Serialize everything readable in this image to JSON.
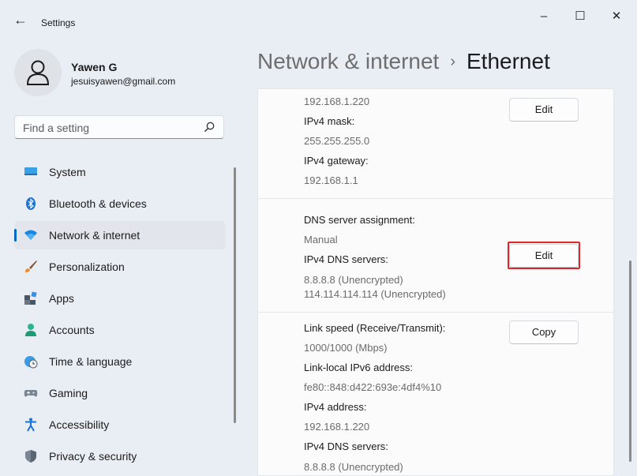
{
  "window": {
    "title": "Settings"
  },
  "profile": {
    "name": "Yawen G",
    "email": "jesuisyawen@gmail.com"
  },
  "search": {
    "placeholder": "Find a setting"
  },
  "sidebar": {
    "items": [
      {
        "label": "System",
        "icon": "system-icon"
      },
      {
        "label": "Bluetooth & devices",
        "icon": "bluetooth-icon"
      },
      {
        "label": "Network & internet",
        "icon": "wifi-icon",
        "active": true
      },
      {
        "label": "Personalization",
        "icon": "brush-icon"
      },
      {
        "label": "Apps",
        "icon": "apps-icon"
      },
      {
        "label": "Accounts",
        "icon": "person-icon"
      },
      {
        "label": "Time & language",
        "icon": "globe-clock-icon"
      },
      {
        "label": "Gaming",
        "icon": "gamepad-icon"
      },
      {
        "label": "Accessibility",
        "icon": "accessibility-icon"
      },
      {
        "label": "Privacy & security",
        "icon": "shield-icon"
      }
    ]
  },
  "breadcrumb": {
    "parent": "Network & internet",
    "separator": "›",
    "current": "Ethernet"
  },
  "ip_card": {
    "ip_value": "192.168.1.220",
    "mask_label": "IPv4 mask:",
    "mask_value": "255.255.255.0",
    "gateway_label": "IPv4 gateway:",
    "gateway_value": "192.168.1.1",
    "edit_label": "Edit"
  },
  "dns_card": {
    "assignment_label": "DNS server assignment:",
    "assignment_value": "Manual",
    "servers_label": "IPv4 DNS servers:",
    "servers": [
      "8.8.8.8 (Unencrypted)",
      "114.114.114.114 (Unencrypted)"
    ],
    "edit_label": "Edit"
  },
  "properties_card": {
    "link_speed_label": "Link speed (Receive/Transmit):",
    "link_speed_value": "1000/1000 (Mbps)",
    "ipv6_label": "Link-local IPv6 address:",
    "ipv6_value": "fe80::848:d422:693e:4df4%10",
    "ipv4_label": "IPv4 address:",
    "ipv4_value": "192.168.1.220",
    "dns_label": "IPv4 DNS servers:",
    "dns_value": "8.8.8.8 (Unencrypted)",
    "copy_label": "Copy"
  },
  "colors": {
    "accent": "#0067c0",
    "highlight": "#e0262a",
    "background": "#e9eef5"
  }
}
